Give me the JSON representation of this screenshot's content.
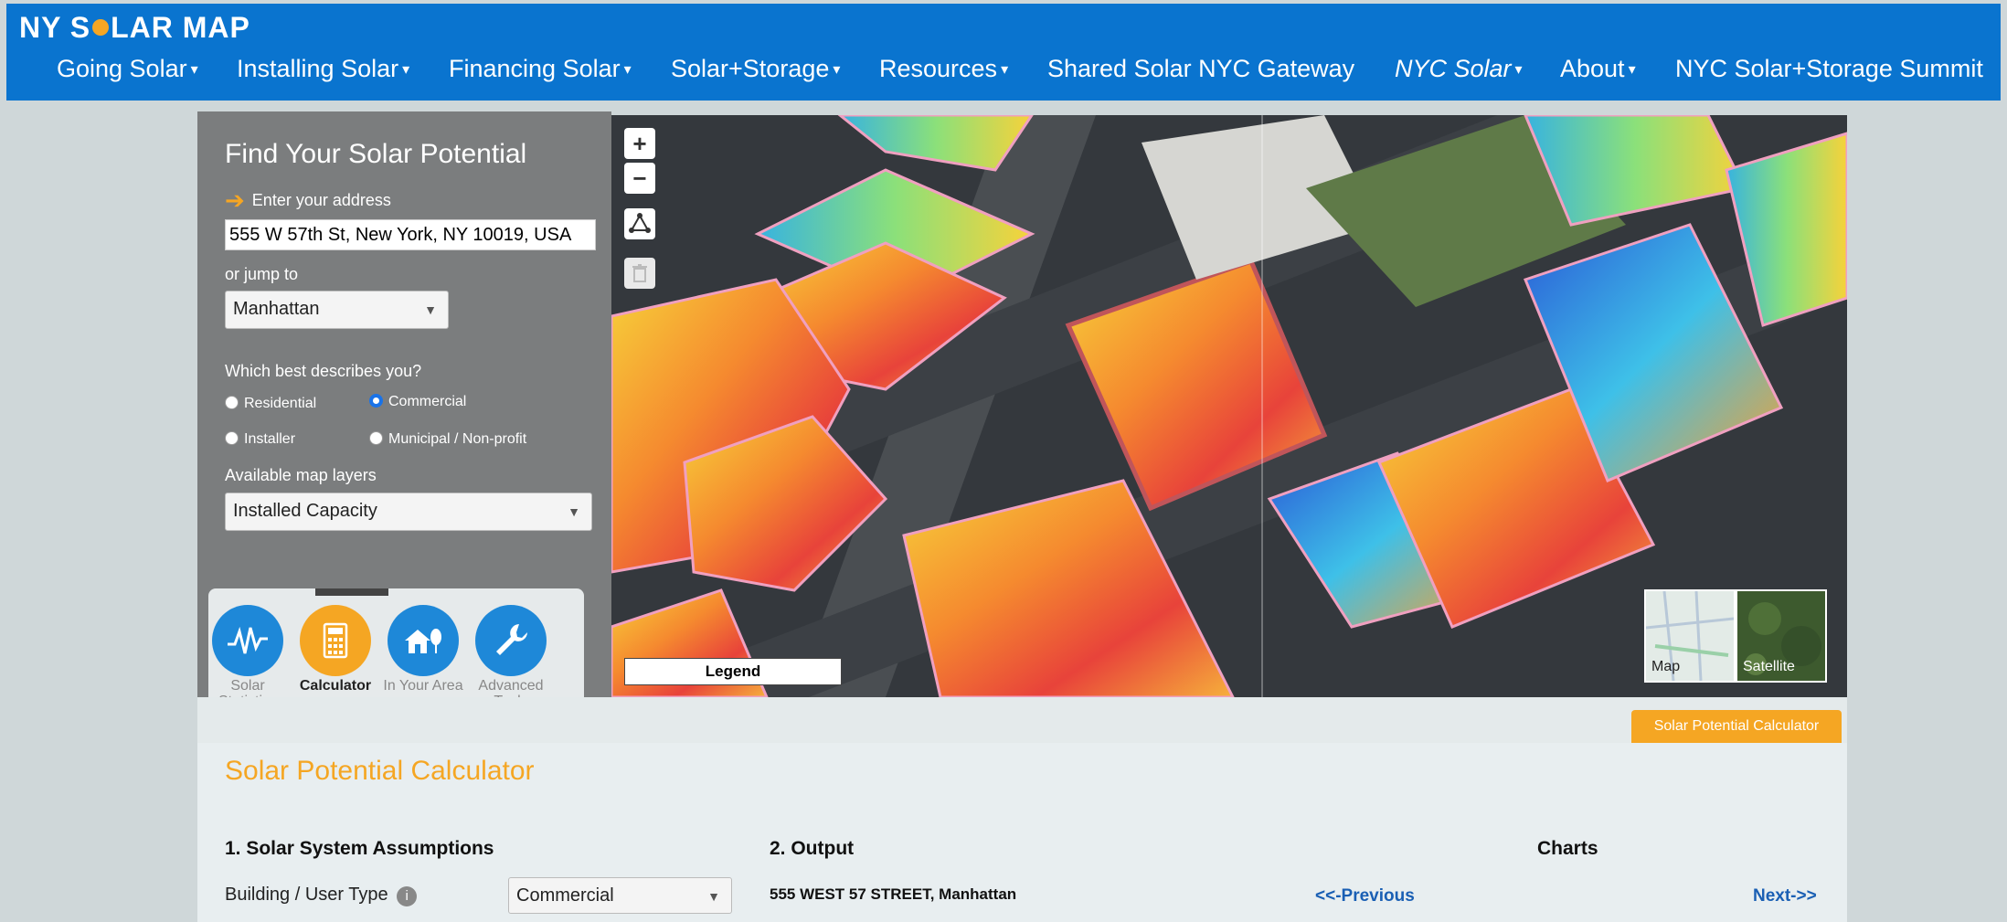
{
  "header": {
    "logo": "NY SOLAR MAP",
    "nav": [
      {
        "label": "Going Solar",
        "dropdown": true
      },
      {
        "label": "Installing Solar",
        "dropdown": true
      },
      {
        "label": "Financing Solar",
        "dropdown": true
      },
      {
        "label": "Solar+Storage",
        "dropdown": true
      },
      {
        "label": "Resources",
        "dropdown": true
      },
      {
        "label": "Shared Solar NYC Gateway",
        "dropdown": false
      },
      {
        "label": "NYC Solar",
        "dropdown": true
      },
      {
        "label": "About",
        "dropdown": true
      },
      {
        "label": "NYC Solar+Storage Summit",
        "dropdown": false
      }
    ],
    "caret": "▾"
  },
  "panel": {
    "title": "Find Your Solar Potential",
    "address_prompt": "Enter your address",
    "address_value": "555 W 57th St, New York, NY 10019, USA",
    "jump_label": "or jump to",
    "jump_value": "Manhattan",
    "describe_label": "Which best describes you?",
    "options": {
      "residential": "Residential",
      "commercial": "Commercial",
      "installer": "Installer",
      "municipal": "Municipal / Non-profit"
    },
    "selected_option": "Commercial",
    "layers_label": "Available map layers",
    "layers_value": "Installed Capacity",
    "tools": {
      "stats": "Solar Statistics",
      "calc": "Calculator",
      "area": "In Your Area",
      "advanced": "Advanced Tools"
    },
    "active_tool": "Calculator"
  },
  "map": {
    "zoom_in": "+",
    "zoom_out": "−",
    "legend": "Legend",
    "basemap_map": "Map",
    "basemap_satellite": "Satellite"
  },
  "calculator": {
    "tab": "Solar Potential Calculator",
    "title": "Solar Potential Calculator",
    "assumptions_heading": "1. Solar System Assumptions",
    "output_heading": "2. Output",
    "charts_heading": "Charts",
    "user_type_label": "Building / User Type",
    "user_type_value": "Commercial",
    "info": "i",
    "output_address": "555 WEST 57 STREET, Manhattan",
    "previous": "<<-Previous",
    "next": "Next->>"
  },
  "colors": {
    "nav_blue": "#0a74cf",
    "accent_orange": "#f5a623",
    "panel_gray": "#7b7d7e",
    "tool_blue": "#1e88d8"
  }
}
